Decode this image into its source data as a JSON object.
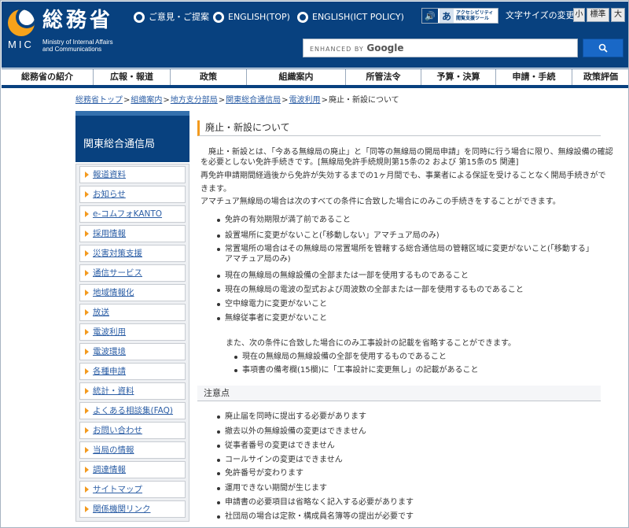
{
  "header": {
    "logo_ja": "総務省",
    "logo_mic": "MIC",
    "logo_en_line1": "Ministry of Internal Affairs",
    "logo_en_line2": "and Communications",
    "links": [
      "ご意見・ご提案",
      "ENGLISH(TOP)",
      "ENGLISH(ICT POLICY)"
    ],
    "accessibility_line1": "アクセシビリティ",
    "accessibility_line2": "閲覧支援ツール",
    "accessibility_letter": "あ",
    "font_size_label": "文字サイズの変更",
    "font_sizes": [
      "小",
      "標準",
      "大"
    ],
    "search_enhanced": "ENHANCED BY",
    "search_google": "Google"
  },
  "nav": [
    "総務省の紹介",
    "広報・報道",
    "政策",
    "組織案内",
    "所管法令",
    "予算・決算",
    "申請・手続",
    "政策評価"
  ],
  "breadcrumb": {
    "links": [
      "総務省トップ",
      "組織案内",
      "地方支分部局",
      "関東総合通信局",
      "電波利用"
    ],
    "current": "廃止・新設について",
    "separator": ">"
  },
  "sidebar": {
    "title": "関東総合通信局",
    "items": [
      "報道資料",
      "お知らせ",
      "e-コムフォKANTO",
      "採用情報",
      "災害対策支援",
      "通信サービス",
      "地域情報化",
      "放送",
      "電波利用",
      "電波環境",
      "各種申請",
      "統計・資料",
      "よくある相談集(FAQ)",
      "お問い合わせ",
      "当局の情報",
      "調達情報",
      "サイトマップ",
      "関係機関リンク"
    ]
  },
  "main": {
    "title": "廃止・新設について",
    "intro_lines": [
      "　廃止・新設とは、「今ある無線局の廃止」と「同等の無線局の開局申請」を同時に行う場合に限り、無線設備の確認",
      "を必要としない免許手続きです。[無線局免許手続規則第15条の2 および 第15条の5 関連]",
      "再免許申請期間経過後から免許が失効するまでの1ヶ月間でも、事業者による保証を受けることなく開局手続きがで",
      "きます。",
      "アマチュア無線局の場合は次のすべての条件に合致した場合にのみこの手続きをすることができます。"
    ],
    "conditions": [
      "免許の有効期限が満了前であること",
      "設置場所に変更がないこと(「移動しない」アマチュア局のみ)",
      "常置場所の場合はその無線局の常置場所を管轄する総合通信局の管轄区域に変更がないこと(「移動する」アマチュア局のみ)",
      "現在の無線局の無線設備の全部または一部を使用するものであること",
      "現在の無線局の電波の型式および周波数の全部または一部を使用するものであること",
      "空中線電力に変更がないこと",
      "無線従事者に変更がないこと"
    ],
    "omit_intro": "また、次の条件に合致した場合にのみ工事設計の記載を省略することができます。",
    "omit_conditions": [
      "現在の無線局の無線設備の全部を使用するものであること",
      "事項書の備考欄(15欄)に「工事設計に変更無し」の記載があること"
    ],
    "notes_title": "注意点",
    "notes": [
      "廃止届を同時に提出する必要があります",
      "撤去以外の無線設備の変更はできません",
      "従事者番号の変更はできません",
      "コールサインの変更はできません",
      "免許番号が変わります",
      "運用できない期間が生じます",
      "申請書の必要項目は省略なく記入する必要があります",
      "社団局の場合は定款・構成員名簿等の提出が必要です"
    ]
  }
}
